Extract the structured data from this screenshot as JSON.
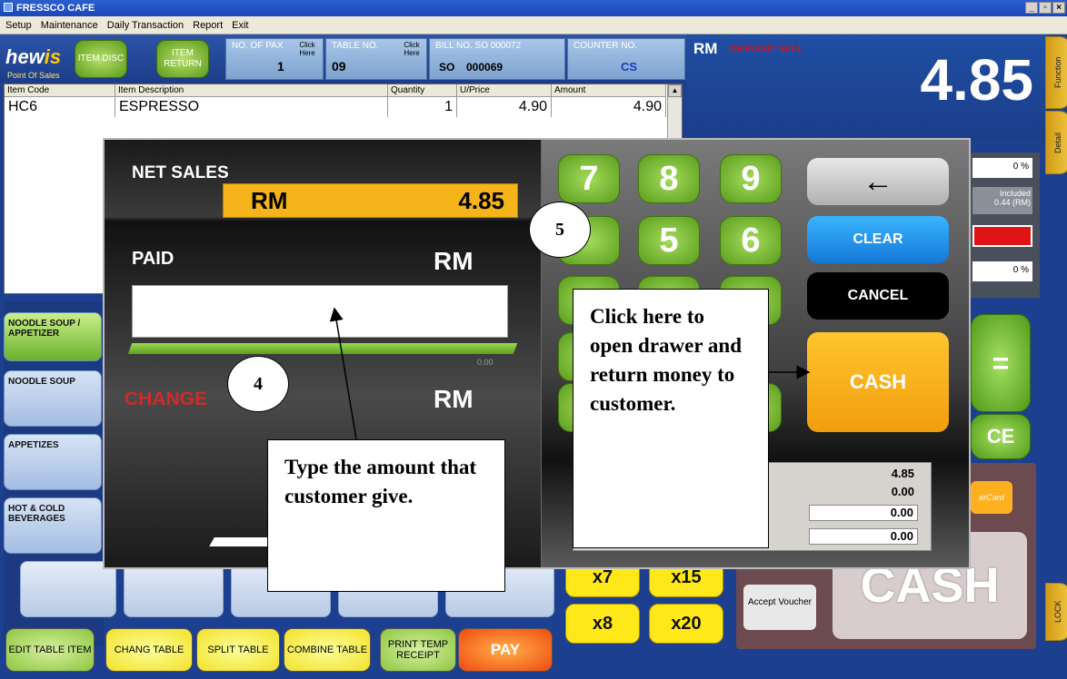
{
  "window": {
    "title": "FRESSCO CAFE",
    "controls": [
      "_",
      "̅",
      "×"
    ]
  },
  "menu": [
    "Setup",
    "Maintenance",
    "Daily Transaction",
    "Report",
    "Exit"
  ],
  "logo": {
    "main": "hew",
    "accent": "is",
    "sub": "Point Of Sales"
  },
  "header": {
    "item_disc": "ITEM DISC",
    "item_return": "ITEM RETURN",
    "no_of_pax_label": "NO. OF PAX",
    "no_of_pax_value": "1",
    "click_here": "Click Here",
    "table_no_label": "TABLE NO.",
    "table_no_value": "09",
    "bill_no_label": "BILL NO. SO 000072",
    "bill_prefix": "SO",
    "bill_value": "000069",
    "counter_no_label": "COUNTER NO.",
    "counter_no_value": "CS"
  },
  "display": {
    "currency": "RM",
    "mode": "DEPOSIT BILL",
    "amount": "4.85"
  },
  "side_tabs": {
    "function": "Function",
    "detail": "Detail",
    "lock": "LOCK"
  },
  "grid": {
    "columns": [
      "Item Code",
      "Item Description",
      "Quantity",
      "U/Price",
      "Amount"
    ],
    "rows": [
      {
        "code": "HC6",
        "desc": "ESPRESSO",
        "qty": "1",
        "price": "4.90",
        "amount": "4.90"
      }
    ]
  },
  "categories": [
    "NOODLE SOUP / APPETIZER",
    "NOODLE SOUP",
    "APPETIZES",
    "HOT & COLD BEVERAGES"
  ],
  "right_panel": {
    "pct1": "0",
    "included": "Included",
    "included_val": "0.44 (RM)",
    "pct2": "0",
    "mastercard": "erCard",
    "accept_voucher": "Accept Voucher",
    "cash_big": "CASH",
    "equals": "=",
    "ce": "CE"
  },
  "multipliers": [
    "x7",
    "x15",
    "x8",
    "x20"
  ],
  "bottom_buttons": [
    "EDIT TABLE ITEM",
    "CHANG TABLE",
    "SPLIT TABLE",
    "COMBINE TABLE",
    "PRINT TEMP RECEIPT",
    "PAY"
  ],
  "payment": {
    "net_sales_label": "NET SALES",
    "net_sales_currency": "RM",
    "net_sales_value": "4.85",
    "paid_label": "PAID",
    "paid_currency": "RM",
    "paid_hint": "0.00",
    "change_label": "CHANGE",
    "change_currency": "RM",
    "keys": [
      "7",
      "8",
      "9",
      "5",
      "6"
    ],
    "backspace": "←",
    "clear": "CLEAR",
    "cancel": "CANCEL",
    "cash": "CASH",
    "summary": [
      "4.85",
      "0.00",
      "0.00",
      "0.00"
    ]
  },
  "annotations": {
    "step4": "4",
    "step5": "5",
    "callout_type": "Type the amount that customer give.",
    "callout_click": "Click here to open drawer and return money to customer."
  }
}
